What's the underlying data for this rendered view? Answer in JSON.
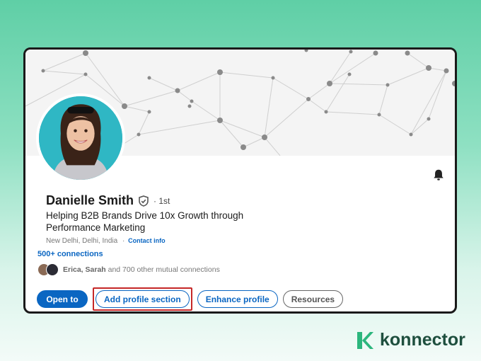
{
  "profile": {
    "name": "Danielle Smith",
    "degree": "· 1st",
    "headline": "Helping B2B Brands Drive 10x Growth through Performance Marketing",
    "location": "New Delhi, Delhi, India",
    "location_sep": "·",
    "contact_info": "Contact info",
    "connections": "500+ connections",
    "mutual_names": "Erica, Sarah",
    "mutual_text": "and 700 other mutual connections"
  },
  "actions": {
    "open_to": "Open to",
    "add_section": "Add profile section",
    "enhance": "Enhance profile",
    "resources": "Resources"
  },
  "brand": {
    "name": "konnector"
  },
  "colors": {
    "accent": "#0a66c2",
    "highlight": "#c62828",
    "brand": "#1e4f3e",
    "avatar_bg": "#2fb7c4"
  },
  "icons": [
    "bell-icon",
    "verified-shield-icon",
    "konnector-logo-icon"
  ]
}
